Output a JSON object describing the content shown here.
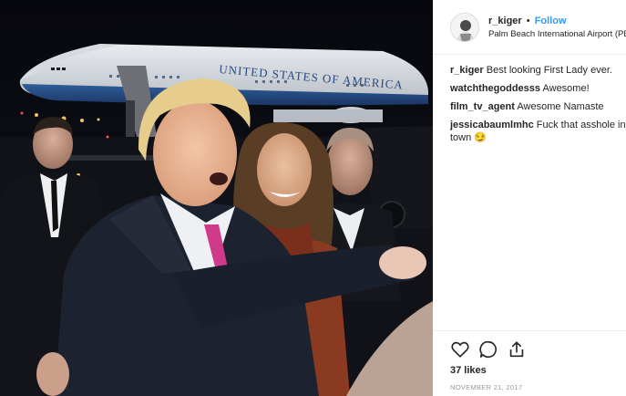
{
  "post": {
    "username": "r_kiger",
    "separator": "•",
    "follow_label": "Follow",
    "location": "Palm Beach International Airport (PBI)",
    "photo_text": "UNITED STATES OF AMERICA",
    "comments": [
      {
        "author": "r_kiger",
        "text": "Best looking First Lady ever."
      },
      {
        "author": "watchthegoddesss",
        "text": "Awesome!"
      },
      {
        "author": "film_tv_agent",
        "text": "Awesome Namaste"
      },
      {
        "author": "jessicabaumlmhc",
        "text": "Fuck that asshole in town 😏"
      }
    ],
    "likes": "37 likes",
    "date": "NOVEMBER 21, 2017"
  },
  "icons": {
    "like": "heart-icon",
    "comment": "comment-icon",
    "share": "share-icon"
  },
  "colors": {
    "follow": "#3897f0",
    "text": "#262626",
    "muted": "#999999",
    "divider": "#efefef"
  }
}
